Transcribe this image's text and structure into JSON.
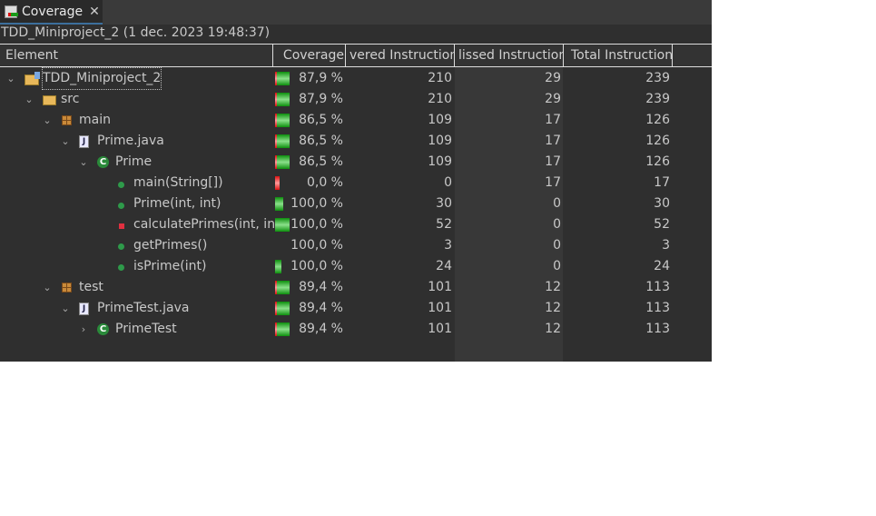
{
  "tab": {
    "label": "Coverage",
    "close": "✕",
    "icon": "coverage-icon"
  },
  "session": "TDD_Miniproject_2 (1 dec. 2023 19:48:37)",
  "columns": [
    "Element",
    "Coverage",
    "vered Instructions",
    "lissed Instructions",
    "Total Instructions"
  ],
  "sort_indicator": "﹀",
  "colors": {
    "covered": "#1a9a1a",
    "missed": "#dd1111",
    "accent": "#3c6f9c"
  },
  "rows": [
    {
      "level": 0,
      "expand": "expanded",
      "icon": "project-icon",
      "name": "TDD_Miniproject_2",
      "coverage": "87,9 %",
      "covered": "210",
      "missed": "29",
      "total": "239",
      "bar_fill": 1.0,
      "selected": true
    },
    {
      "level": 1,
      "expand": "expanded",
      "icon": "source-folder-icon",
      "name": "src",
      "coverage": "87,9 %",
      "covered": "210",
      "missed": "29",
      "total": "239",
      "bar_fill": 1.0
    },
    {
      "level": 2,
      "expand": "expanded",
      "icon": "package-icon",
      "name": "main",
      "coverage": "86,5 %",
      "covered": "109",
      "missed": "17",
      "total": "126",
      "bar_fill": 1.0
    },
    {
      "level": 3,
      "expand": "expanded",
      "icon": "java-file-icon",
      "name": "Prime.java",
      "coverage": "86,5 %",
      "covered": "109",
      "missed": "17",
      "total": "126",
      "bar_fill": 1.0
    },
    {
      "level": 4,
      "expand": "expanded",
      "icon": "class-icon",
      "name": "Prime",
      "coverage": "86,5 %",
      "covered": "109",
      "missed": "17",
      "total": "126",
      "bar_fill": 1.0
    },
    {
      "level": 5,
      "expand": "none",
      "icon": "static-method-icon",
      "name": "main(String[])",
      "coverage": "0,0 %",
      "covered": "0",
      "missed": "17",
      "total": "17",
      "bar_fill": 0.33
    },
    {
      "level": 5,
      "expand": "none",
      "icon": "constructor-icon",
      "name": "Prime(int, int)",
      "coverage": "100,0 %",
      "covered": "30",
      "missed": "0",
      "total": "30",
      "bar_fill": 0.58
    },
    {
      "level": 5,
      "expand": "none",
      "icon": "private-method-icon",
      "name": "calculatePrimes(int, int)",
      "coverage": "100,0 %",
      "covered": "52",
      "missed": "0",
      "total": "52",
      "bar_fill": 1.0
    },
    {
      "level": 5,
      "expand": "none",
      "icon": "public-method-icon",
      "name": "getPrimes()",
      "coverage": "100,0 %",
      "covered": "3",
      "missed": "0",
      "total": "3",
      "bar_fill": 0.06
    },
    {
      "level": 5,
      "expand": "none",
      "icon": "public-method-icon",
      "name": "isPrime(int)",
      "coverage": "100,0 %",
      "covered": "24",
      "missed": "0",
      "total": "24",
      "bar_fill": 0.46
    },
    {
      "level": 2,
      "expand": "expanded",
      "icon": "package-icon",
      "name": "test",
      "coverage": "89,4 %",
      "covered": "101",
      "missed": "12",
      "total": "113",
      "bar_fill": 1.0
    },
    {
      "level": 3,
      "expand": "expanded",
      "icon": "java-file-icon",
      "name": "PrimeTest.java",
      "coverage": "89,4 %",
      "covered": "101",
      "missed": "12",
      "total": "113",
      "bar_fill": 1.0
    },
    {
      "level": 4,
      "expand": "collapsed",
      "icon": "test-class-icon",
      "name": "PrimeTest",
      "coverage": "89,4 %",
      "covered": "101",
      "missed": "12",
      "total": "113",
      "bar_fill": 1.0
    }
  ]
}
